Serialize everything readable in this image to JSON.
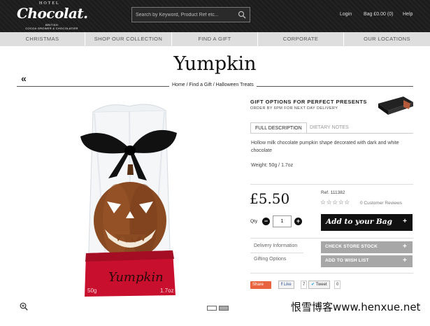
{
  "header": {
    "logo_hotel": "HOTEL",
    "logo_main": "Chocolat.",
    "logo_tagline_1": "BRITISH",
    "logo_tagline_2": "COCOA GROWER & CHOCOLATIER",
    "search_placeholder": "Search by Keyword, Product Ref etc...",
    "login": "Login",
    "bag": "Bag £0.00 (0)",
    "help": "Help"
  },
  "nav": [
    "CHRISTMAS",
    "SHOP OUR COLLECTION",
    "FIND A GIFT",
    "CORPORATE",
    "OUR LOCATIONS"
  ],
  "product": {
    "title": "Yumpkin",
    "breadcrumb": "Home  / Find a Gift  / Halloween Treats",
    "box_text": "Yumpkin",
    "box_weight_left": "50g",
    "box_weight_right": "1.7oz",
    "price": "£5.50",
    "ref": "Ref. 111382",
    "stars": "☆☆☆☆☆",
    "reviews": "0 Customer Reviews",
    "description": "Hollow milk chocolate pumpkin shape decorated with dark and white chocolate",
    "weight": "Weight: 50g / 1.7oz"
  },
  "gift": {
    "title": "GIFT OPTIONS FOR PERFECT PRESENTS",
    "subtitle": "ORDER BY 6PM FOR NEXT DAY DELIVERY"
  },
  "tabs": {
    "full_description": "FULL DESCRIPTION",
    "dietary_notes": "DIETARY NOTES"
  },
  "purchase": {
    "qty_label": "Qty",
    "qty_value": "1",
    "add_to_bag": "Add to your Bag",
    "check_store_stock": "CHECK STORE STOCK",
    "add_to_wish_list": "ADD TO WISH LIST",
    "delivery_information": "Delivery Information",
    "gifting_options": "Gifting Options"
  },
  "social": {
    "share": "Share",
    "like": "Like",
    "like_count": "7",
    "tweet": "Tweet",
    "tweet_count": "0"
  },
  "watermark": "恨雪博客www.henxue.net",
  "colors": {
    "header_bg": "#1c1c1c",
    "nav_bg": "#dedede",
    "add_bag_bg": "#111111",
    "grey_button": "#a7a7a7",
    "share_orange": "#e8643e",
    "pumpkin": "#8a4a22",
    "box_red": "#c8102e"
  }
}
